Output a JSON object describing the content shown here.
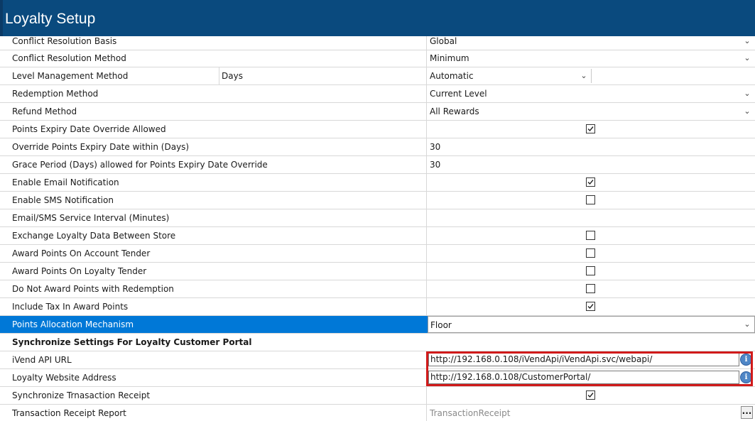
{
  "header": {
    "title": "Loyalty Setup"
  },
  "rows": {
    "conflict_basis": {
      "label": "Conflict Resolution Basis",
      "value": "Global"
    },
    "conflict_method": {
      "label": "Conflict Resolution Method",
      "value": "Minimum"
    },
    "level_mgmt": {
      "label": "Level Management Method",
      "sub": "Days",
      "value": "Automatic"
    },
    "redemption": {
      "label": "Redemption Method",
      "value": "Current Level"
    },
    "refund": {
      "label": "Refund Method",
      "value": "All Rewards"
    },
    "expiry_override": {
      "label": "Points Expiry Date Override Allowed",
      "checked": true
    },
    "override_within": {
      "label": "Override Points Expiry Date within (Days)",
      "value": "30"
    },
    "grace_period": {
      "label": "Grace Period (Days) allowed for Points Expiry Date Override",
      "value": "30"
    },
    "email_notif": {
      "label": "Enable Email Notification",
      "checked": true
    },
    "sms_notif": {
      "label": "Enable SMS Notification",
      "checked": false
    },
    "service_interval": {
      "label": "Email/SMS Service Interval (Minutes)",
      "value": ""
    },
    "exchange_data": {
      "label": "Exchange Loyalty Data Between Store",
      "checked": false
    },
    "award_account": {
      "label": "Award Points On Account Tender",
      "checked": false
    },
    "award_loyalty": {
      "label": "Award Points On Loyalty Tender",
      "checked": false
    },
    "no_award_redemption": {
      "label": "Do Not Award Points with Redemption",
      "checked": false
    },
    "include_tax": {
      "label": "Include Tax In Award Points",
      "checked": true
    },
    "allocation": {
      "label": "Points Allocation Mechanism",
      "value": "Floor"
    },
    "sync_group": {
      "label": "Synchronize Settings For Loyalty Customer Portal"
    },
    "api_url": {
      "label": "iVend API URL",
      "value": "http://192.168.0.108/iVendApi/iVendApi.svc/webapi/"
    },
    "website": {
      "label": "Loyalty Website Address",
      "value": "http://192.168.0.108/CustomerPortal/"
    },
    "sync_receipt": {
      "label": "Synchronize Trnasaction Receipt",
      "checked": true
    },
    "receipt_report": {
      "label": "Transaction Receipt Report",
      "value": "TransactionReceipt"
    }
  },
  "icons": {
    "info": "i",
    "ellipsis": "...",
    "chevron": "⌄"
  },
  "colors": {
    "header": "#0a4a7e",
    "selection": "#0078d7",
    "highlight": "#d11a1a"
  }
}
